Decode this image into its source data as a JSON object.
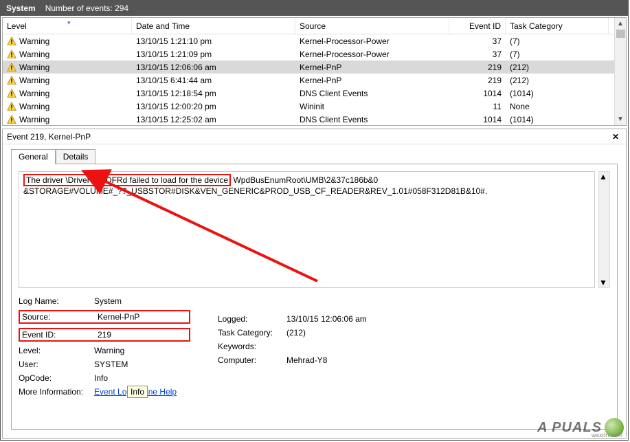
{
  "titlebar": {
    "title": "System",
    "count_label": "Number of events: 294"
  },
  "columns": {
    "level": "Level",
    "date": "Date and Time",
    "source": "Source",
    "eventid": "Event ID",
    "task": "Task Category"
  },
  "rows": [
    {
      "level": "Warning",
      "date": "13/10/15 1:21:10 pm",
      "source": "Kernel-Processor-Power",
      "eventid": "37",
      "task": "(7)",
      "selected": false
    },
    {
      "level": "Warning",
      "date": "13/10/15 1:21:09 pm",
      "source": "Kernel-Processor-Power",
      "eventid": "37",
      "task": "(7)",
      "selected": false
    },
    {
      "level": "Warning",
      "date": "13/10/15 12:06:06 am",
      "source": "Kernel-PnP",
      "eventid": "219",
      "task": "(212)",
      "selected": true
    },
    {
      "level": "Warning",
      "date": "13/10/15 6:41:44 am",
      "source": "Kernel-PnP",
      "eventid": "219",
      "task": "(212)",
      "selected": false
    },
    {
      "level": "Warning",
      "date": "13/10/15 12:18:54 pm",
      "source": "DNS Client Events",
      "eventid": "1014",
      "task": "(1014)",
      "selected": false
    },
    {
      "level": "Warning",
      "date": "13/10/15 12:00:20 pm",
      "source": "Wininit",
      "eventid": "11",
      "task": "None",
      "selected": false
    },
    {
      "level": "Warning",
      "date": "13/10/15 12:25:02 am",
      "source": "DNS Client Events",
      "eventid": "1014",
      "task": "(1014)",
      "selected": false
    }
  ],
  "detail_header": "Event 219, Kernel-PnP",
  "tabs": {
    "general": "General",
    "details": "Details"
  },
  "description": {
    "hl_text": "The driver \\Driver\\WUDFRd failed to load for the device",
    "rest_line1": " WpdBusEnumRoot\\UMB\\2&37c186b&0",
    "line2": "&STORAGE#VOLUME#_??_USBSTOR#DISK&VEN_GENERIC&PROD_USB_CF_READER&REV_1.01#058F312D81B&10#."
  },
  "fields_left": {
    "logname": {
      "label": "Log Name:",
      "value": "System"
    },
    "source": {
      "label": "Source:",
      "value": "Kernel-PnP",
      "boxed": true
    },
    "eventid": {
      "label": "Event ID:",
      "value": "219",
      "boxed": true
    },
    "level": {
      "label": "Level:",
      "value": "Warning"
    },
    "user": {
      "label": "User:",
      "value": "SYSTEM"
    },
    "opcode": {
      "label": "OpCode:",
      "value": "Info"
    },
    "moreinfo": {
      "label": "More Information:",
      "value": "Event Log Online Help"
    }
  },
  "fields_right": {
    "logged": {
      "label": "Logged:",
      "value": "13/10/15 12:06:06 am"
    },
    "taskcat": {
      "label": "Task Category:",
      "value": "(212)"
    },
    "keywords": {
      "label": "Keywords:",
      "value": ""
    },
    "computer": {
      "label": "Computer:",
      "value": "Mehrad-Y8"
    }
  },
  "tooltip": "Info",
  "watermark": "A  PUALS",
  "corner": "wsxdn.com"
}
